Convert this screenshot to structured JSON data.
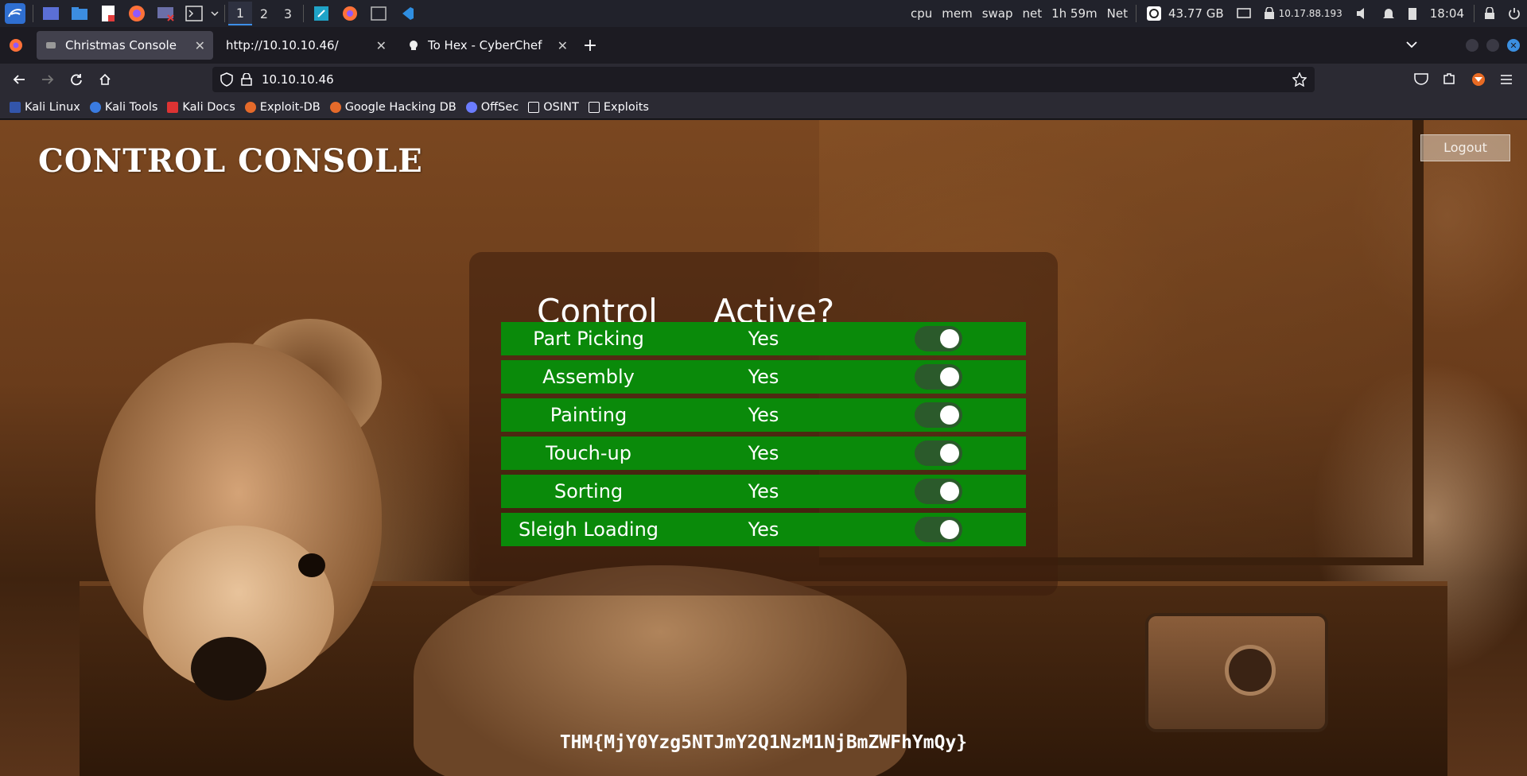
{
  "panel": {
    "workspaces": [
      "1",
      "2",
      "3"
    ],
    "monitors": [
      "cpu",
      "mem",
      "swap",
      "net"
    ],
    "uptime": "1h 59m",
    "net_label": "Net",
    "disk": "43.77 GB",
    "ip": "10.17.88.193",
    "clock": "18:04"
  },
  "tabs": [
    {
      "title": "Christmas Console"
    },
    {
      "title": "http://10.10.10.46/"
    },
    {
      "title": "To Hex - CyberChef"
    }
  ],
  "nav": {
    "url": "10.10.10.46"
  },
  "bookmarks": [
    "Kali Linux",
    "Kali Tools",
    "Kali Docs",
    "Exploit-DB",
    "Google Hacking DB",
    "OffSec",
    "OSINT",
    "Exploits"
  ],
  "page": {
    "title": "CONTROL CONSOLE",
    "logout": "Logout",
    "headers": {
      "control": "Control",
      "active": "Active?"
    },
    "rows": [
      {
        "name": "Part Picking",
        "active": "Yes"
      },
      {
        "name": "Assembly",
        "active": "Yes"
      },
      {
        "name": "Painting",
        "active": "Yes"
      },
      {
        "name": "Touch-up",
        "active": "Yes"
      },
      {
        "name": "Sorting",
        "active": "Yes"
      },
      {
        "name": "Sleigh Loading",
        "active": "Yes"
      }
    ],
    "flag": "THM{MjY0Yzg5NTJmY2Q1NzM1NjBmZWFhYmQy}"
  },
  "colors": {
    "row_green": "#0a8a0a",
    "accent_blue": "#3d8ee8"
  }
}
